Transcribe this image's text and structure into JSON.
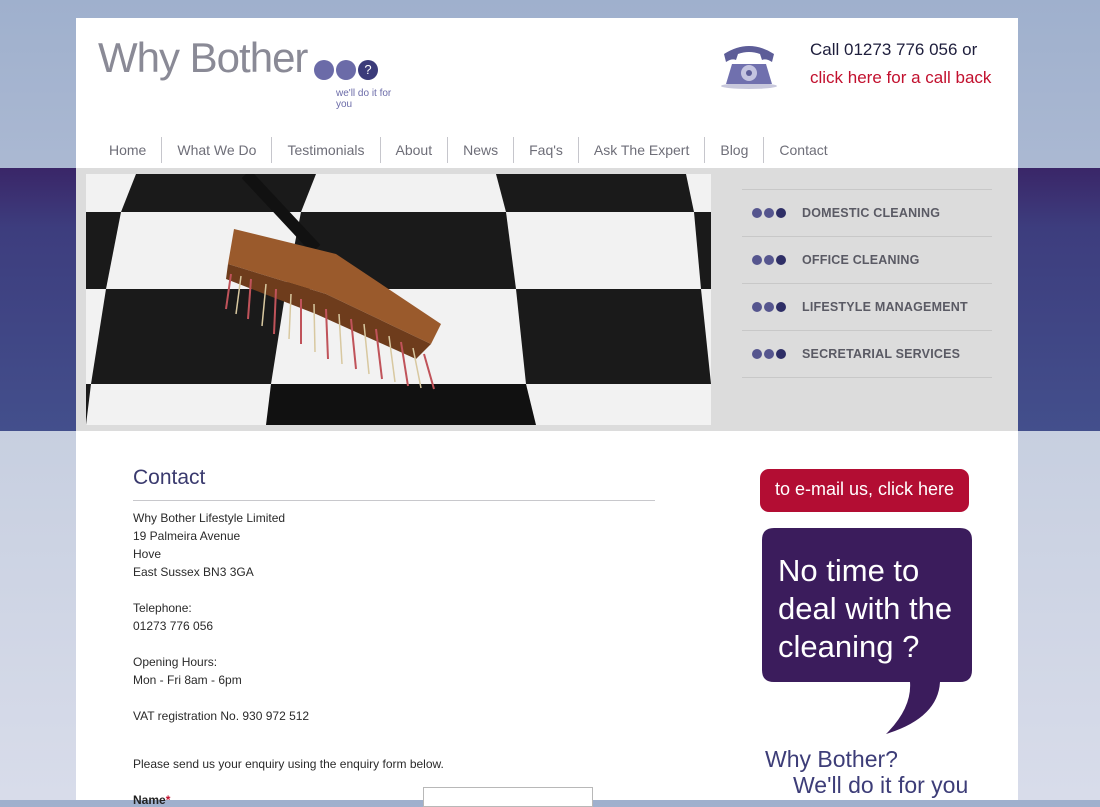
{
  "header": {
    "logo_text": "Why Bother",
    "logo_q": "?",
    "tagline": "we'll do it for you",
    "call_text": "Call 01273 776 056 or",
    "callback_link": "click here for a call back"
  },
  "nav": [
    "Home",
    "What We Do",
    "Testimonials",
    "About",
    "News",
    "Faq's",
    "Ask The Expert",
    "Blog",
    "Contact"
  ],
  "services": [
    "DOMESTIC CLEANING",
    "OFFICE CLEANING",
    "LIFESTYLE MANAGEMENT",
    "SECRETARIAL SERVICES"
  ],
  "content": {
    "title": "Contact",
    "company": "Why Bother Lifestyle Limited",
    "address1": "19 Palmeira Avenue",
    "address2": "Hove",
    "address3": "East Sussex BN3 3GA",
    "tel_label": "Telephone:",
    "tel": "01273 776 056",
    "hours_label": "Opening Hours:",
    "hours": "Mon - Fri 8am - 6pm",
    "vat": "VAT registration No. 930 972 512",
    "form_intro": "Please send us your enquiry using the enquiry form below.",
    "name_label": "Name",
    "required_mark": "*"
  },
  "sidebar": {
    "email_button": "to e-mail us, click here",
    "bubble_text": "No time to deal with the cleaning ?",
    "slogan_line1": "Why Bother?",
    "slogan_line2": "We'll do it for you"
  },
  "colors": {
    "brand_purple": "#3a2668",
    "accent_red": "#b30d33",
    "dot_blue": "#6b6ba8"
  }
}
